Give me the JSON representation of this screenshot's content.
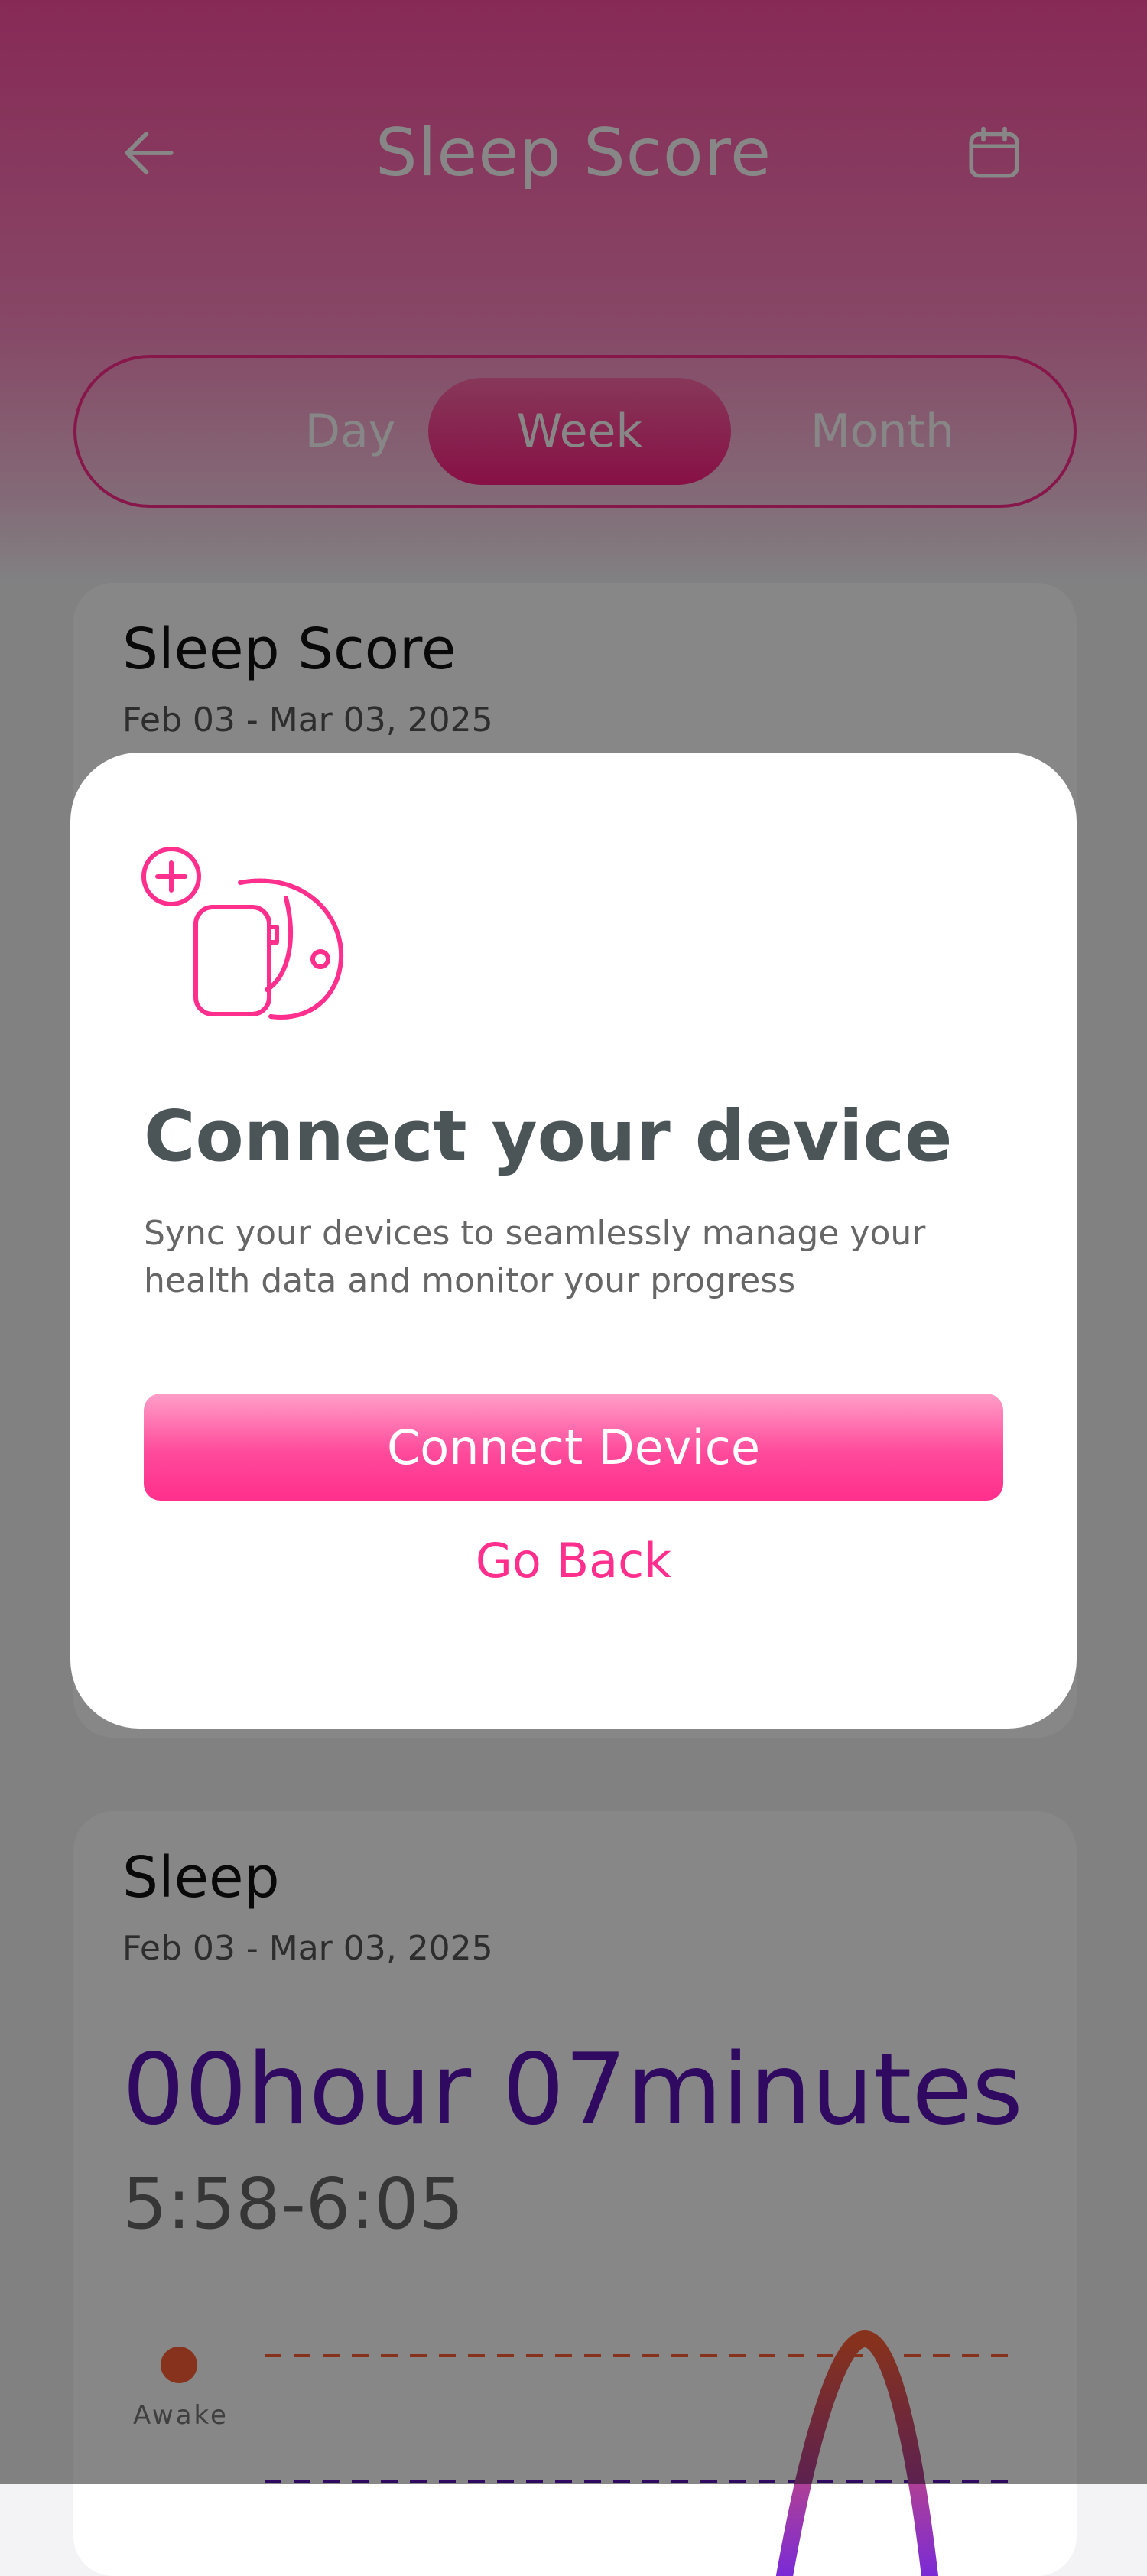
{
  "header": {
    "title": "Sleep Score",
    "back_icon": "arrow-left-icon",
    "calendar_icon": "calendar-icon"
  },
  "segments": {
    "day": "Day",
    "week": "Week",
    "month": "Month",
    "selected": "Week"
  },
  "score_card": {
    "title": "Sleep Score",
    "date_range": "Feb 03 - Mar 03, 2025"
  },
  "sleep_card": {
    "title": "Sleep",
    "date_range": "Feb 03 - Mar 03, 2025",
    "duration": "00hour 07minutes",
    "time_range": "5:58-6:05",
    "legend_awake": "Awake"
  },
  "modal": {
    "icon": "smartwatch-plus-icon",
    "title": "Connect your device",
    "description": "Sync your devices to seamlessly manage your health data and monitor your progress",
    "primary_button": "Connect Device",
    "secondary_button": "Go Back"
  },
  "colors": {
    "accent": "#ff2f8d",
    "purple": "#5b12b8",
    "awake": "#ff5f35"
  }
}
